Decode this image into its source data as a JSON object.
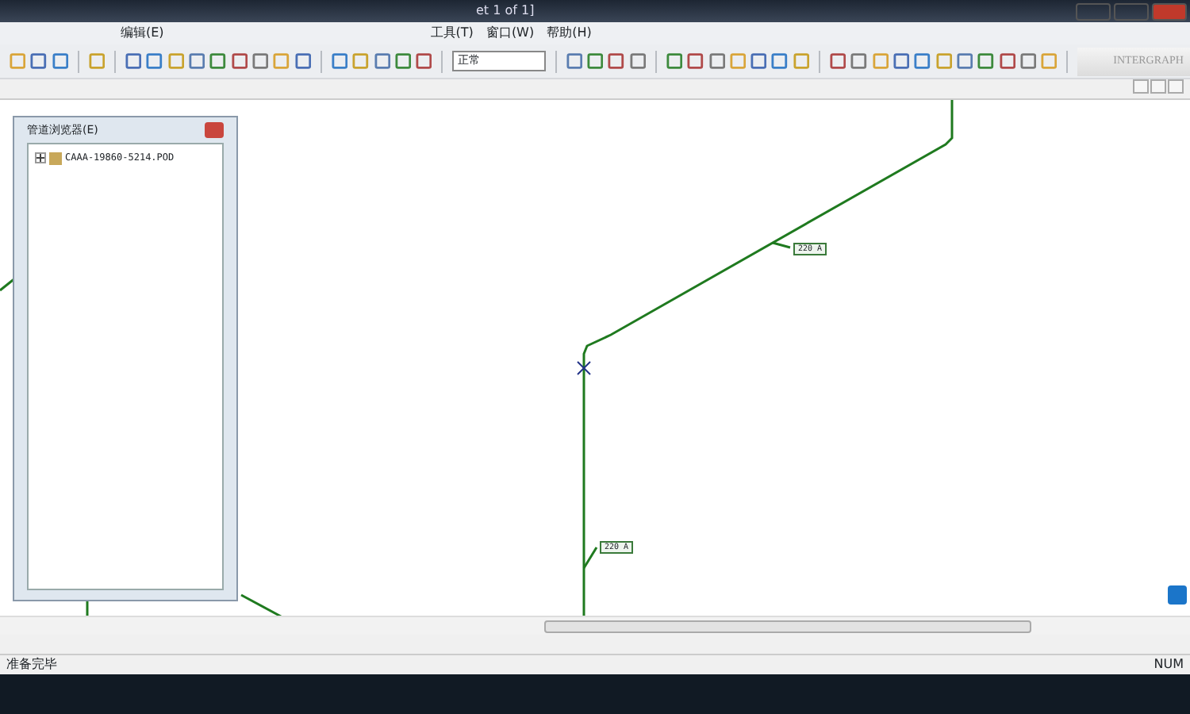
{
  "title_bar": {
    "title": "et 1 of 1]"
  },
  "menu": [
    {
      "label": "编辑(E)"
    },
    {
      "label": "工具(T)"
    },
    {
      "label": "窗口(W)"
    },
    {
      "label": "帮助(H)"
    }
  ],
  "toolbar": {
    "style_select": "正常",
    "logo": "INTERGRAPH"
  },
  "pipeline_browser": {
    "title": "管道浏览器(E)",
    "tree": [
      {
        "label": "CAAA-19860-5214.POD",
        "expanded": false
      }
    ]
  },
  "drawing": {
    "labels": [
      "220 A",
      "220 A"
    ]
  },
  "status_bar": {
    "message": "准备完毕",
    "indicator": "NUM"
  }
}
